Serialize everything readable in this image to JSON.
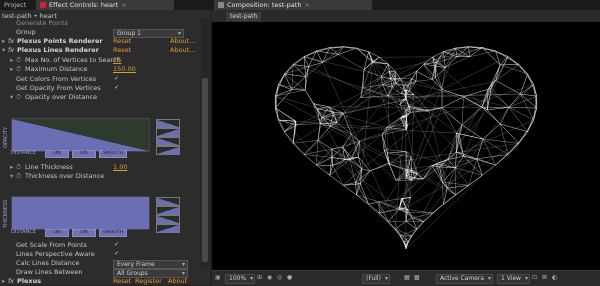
{
  "tabs": {
    "project": "Project",
    "effect_controls": "Effect Controls: heart",
    "composition": "Composition: test-path"
  },
  "left": {
    "breadcrumb": "test-path • heart",
    "cut_top": "Generate Points",
    "group_label": "Group",
    "group_value": "Group 1",
    "points_renderer": {
      "name": "Plexus Points Renderer",
      "reset": "Reset",
      "about": "About..."
    },
    "lines_renderer": {
      "name": "Plexus Lines Renderer",
      "reset": "Reset",
      "about": "About..."
    },
    "max_vertices": {
      "label": "Max No. of Vertices to Search",
      "value": "25"
    },
    "max_distance": {
      "label": "Maximum Distance",
      "value": "150.00"
    },
    "colors_from_vertices": "Get Colors From Vertices",
    "opacity_from_vertices": "Get Opacity From Vertices",
    "opacity_over_distance": "Opacity over Distance",
    "graph1": {
      "ylab": "OPACITY",
      "xlab": "DISTANCE",
      "btns": [
        "LIN",
        "LIN",
        "SMOOTH"
      ],
      "mode_curve": "descending"
    },
    "line_thickness": {
      "label": "Line Thickness",
      "value": "1.00"
    },
    "thickness_over_distance": "Thickness over Distance",
    "graph2": {
      "ylab": "THICKNESS",
      "xlab": "DISTANCE",
      "btns": [
        "LIN",
        "LIN",
        "SMOOTH"
      ]
    },
    "scale_from_points": "Get Scale From Points",
    "lines_perspective": "Lines Perspective Aware",
    "calc_lines_distance": {
      "label": "Calc Lines Distance",
      "value": "Every Frame"
    },
    "draw_lines_between": {
      "label": "Draw Lines Between",
      "value": "All Groups"
    },
    "bottom": {
      "name": "Plexus",
      "reset": "Reset",
      "register": "Register",
      "about": "About"
    }
  },
  "right": {
    "subtab": "test-path",
    "zoom": "100%",
    "quality": "(Full)",
    "camera": "Active Camera",
    "view": "1 View"
  },
  "colors": {
    "accent": "#e79a2c",
    "graph": "#6a6fb4",
    "canvas": "#000000"
  }
}
